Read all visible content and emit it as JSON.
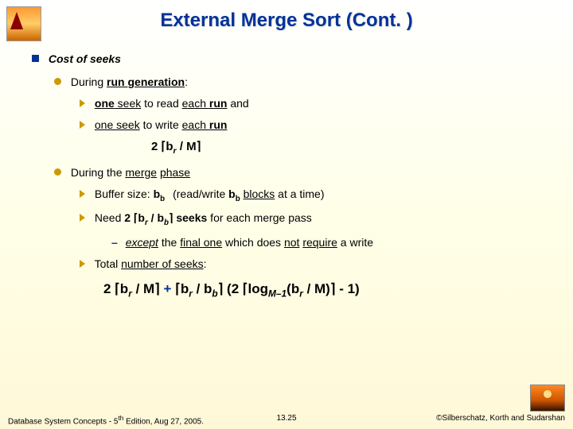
{
  "title": "External Merge Sort (Cont. )",
  "heading1": "Cost of seeks",
  "runGen": {
    "label_pre": "During ",
    "label_b": "run ",
    "label_u": "generation",
    "label_post": ":",
    "item1_a": "one",
    "item1_b": " seek",
    "item1_c": " to read ",
    "item1_d": "each ",
    "item1_e": "run",
    "item1_f": " and",
    "item2_a": " one seek",
    "item2_b": " to write ",
    "item2_c": "each ",
    "item2_d": "run",
    "formula": "2 ⌈b",
    "formula_sub": "r",
    "formula2": " / M⌉"
  },
  "merge": {
    "label_pre": "During the ",
    "label_u": "merge",
    "label_sp": " ",
    "label_u2": "phase",
    "buf1": "Buffer size: ",
    "buf_b": "b",
    "buf_sub": "b",
    "buf_gap": "   ",
    "buf2": "(read/write ",
    "buf_b2": "b",
    "buf_sub2": "b",
    "buf3": " ",
    "buf3u": "blocks",
    "buf4": " at a time)",
    "need1": "Need ",
    "need2": "2 ⌈b",
    "need_sub1": "r",
    "need3": " / b",
    "need_sub2": "b",
    "need4": "⌉ seeks",
    "need5": " for each merge pass",
    "exc1": "except",
    "exc2": " the ",
    "exc3": "final one",
    "exc4": " which does ",
    "exc5": "not",
    "exc6": " ",
    "exc7": "require",
    "exc8": " a write",
    "tot1": "Total ",
    "tot2": "number of seeks",
    "tot3": ":",
    "f1": "2 ⌈b",
    "fs1": "r",
    "f2": " / M⌉",
    "fplus": "  +  ",
    "f3": "⌈b",
    "fs2": "r",
    "f4": " / b",
    "fs3": "b",
    "f5": "⌉ (2 ⌈log",
    "fs4": "M–1",
    "f6": "(b",
    "fs5": "r",
    "f7": " / M)⌉  - 1)"
  },
  "footer": {
    "left_a": "Database System Concepts - 5",
    "left_sup": "th",
    "left_b": " Edition, Aug 27,  2005.",
    "center": "13.25",
    "right": "©Silberschatz, Korth and Sudarshan"
  }
}
